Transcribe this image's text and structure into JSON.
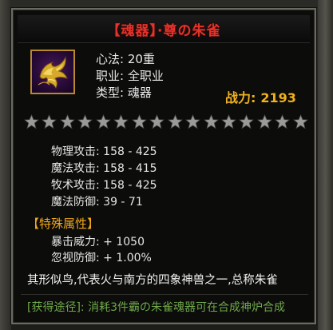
{
  "item": {
    "title": "【魂器】·尊の朱雀",
    "info": {
      "level": "心法: 20重",
      "profession": "职业: 全职业",
      "type": "类型: 魂器"
    },
    "power_label": "战力:",
    "power_value": "2193",
    "stars": {
      "filled": 0,
      "total": 16
    },
    "stats": [
      "物理攻击: 158 - 425",
      "魔法攻击: 158 - 415",
      "牧术攻击: 158 - 425",
      "魔法防御: 39 - 71"
    ],
    "special_title": "【特殊属性】",
    "special": [
      "暴击威力: + 1050",
      "忽视防御: + 1.00%"
    ],
    "description": "其形似鸟,代表火与南方的四象神兽之一,总称朱雀",
    "source": "[获得途径]: 消耗3件霸の朱雀魂器可在合成神炉合成"
  },
  "icon": "phoenix-icon",
  "colors": {
    "title": "#e3332a",
    "power": "#f0b21c",
    "section": "#f0a81e",
    "source": "#6fa84a"
  }
}
